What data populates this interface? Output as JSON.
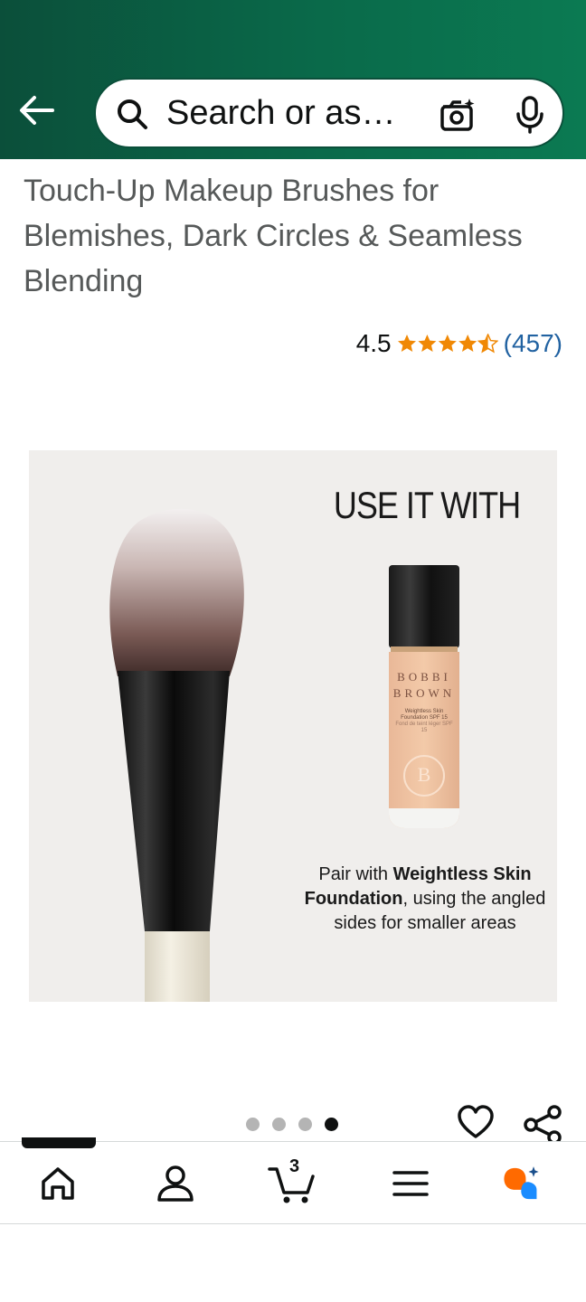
{
  "search": {
    "placeholder": "Search or as…"
  },
  "product": {
    "title": "Touch-Up Makeup Brushes for Blemishes, Dark Circles & Seamless Blending",
    "rating_value": "4.5",
    "rating_fraction": 0.9,
    "review_count": "(457)"
  },
  "image": {
    "headline": "USE IT WITH",
    "bottle_brand_line1": "BOBBI",
    "bottle_brand_line2": "BROWN",
    "bottle_label": "Weightless Skin Foundation SPF 15",
    "bottle_label_fr": "Fond de teint léger SPF 15",
    "bottle_monogram": "B",
    "caption_prefix": "Pair with ",
    "caption_bold": "Weightless Skin Foundation",
    "caption_suffix": ", using the angled sides for smaller areas"
  },
  "carousel": {
    "total": 4,
    "active_index": 3
  },
  "nav": {
    "items": [
      "home",
      "account",
      "cart",
      "menu",
      "rufus"
    ],
    "cart_count": "3"
  },
  "colors": {
    "header_start": "#0b4f3a",
    "header_end": "#0b7a52",
    "star": "#f08804",
    "link": "#2162a1"
  }
}
